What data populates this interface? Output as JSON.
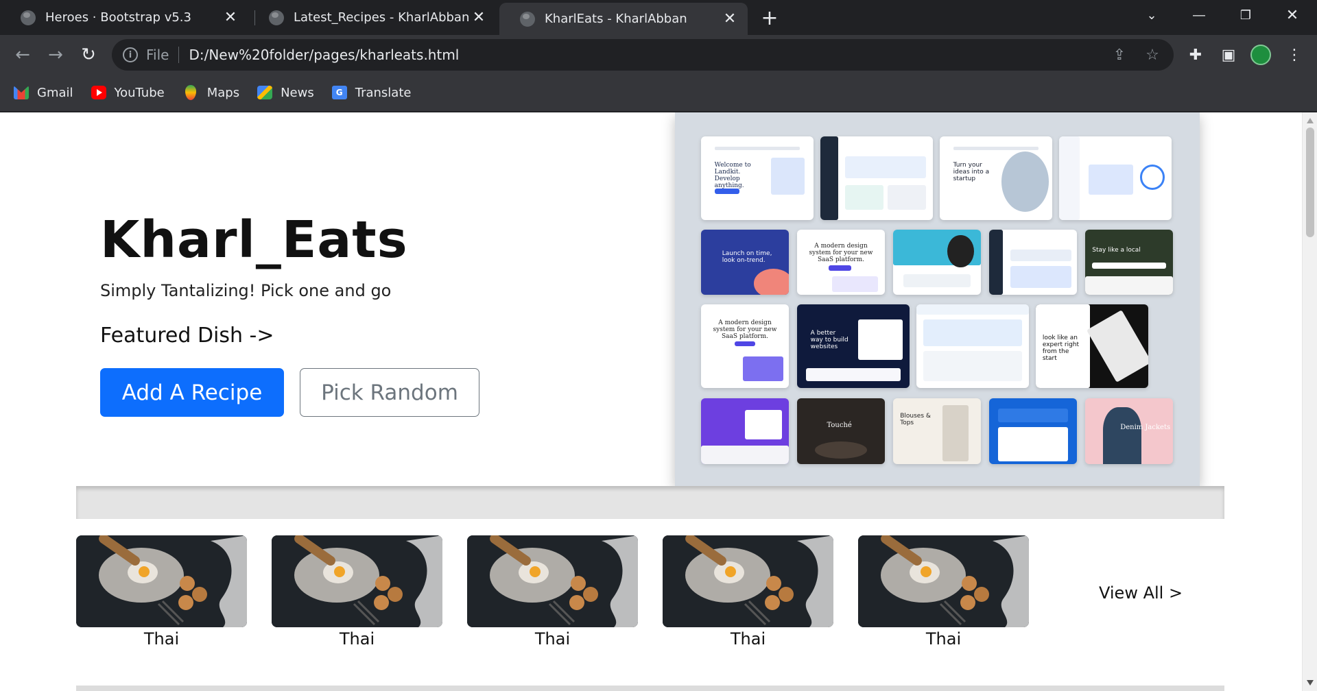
{
  "browser": {
    "tabs": [
      {
        "title": "Heroes · Bootstrap v5.3",
        "active": false
      },
      {
        "title": "Latest_Recipes - KharlAbban",
        "active": false
      },
      {
        "title": "KharlEats - KharlAbban",
        "active": true
      }
    ],
    "address": {
      "scheme_label": "File",
      "url": "D:/New%20folder/pages/kharleats.html"
    },
    "bookmarks": [
      {
        "label": "Gmail",
        "icon": "gmail-icon"
      },
      {
        "label": "YouTube",
        "icon": "youtube-icon"
      },
      {
        "label": "Maps",
        "icon": "maps-icon"
      },
      {
        "label": "News",
        "icon": "news-icon"
      },
      {
        "label": "Translate",
        "icon": "translate-icon"
      }
    ]
  },
  "hero": {
    "title": "Kharl_Eats",
    "lead": "Simply Tantalizing! Pick one and go",
    "featured": "Featured Dish ->",
    "primary_button": "Add A Recipe",
    "secondary_button": "Pick Random"
  },
  "mockups": {
    "row2_col2": "A modern design system for your new SaaS platform.",
    "row3_col1": "A modern design system for your new SaaS platform.",
    "row1_col3": "Turn your ideas into a startup",
    "row2_col1": "Launch on time, look on-trend.",
    "row2_col5": "Stay like a local",
    "row3_col2": "A better way to build websites",
    "row3_col5": "look like an expert right from the start",
    "row4_col3": "Blouses & Tops",
    "row4_col5": "Denim Jackets",
    "row4_col2": "Touché",
    "row1_col1": "Welcome to Landkit. Develop anything."
  },
  "recipes": {
    "cards": [
      {
        "label": "Thai"
      },
      {
        "label": "Thai"
      },
      {
        "label": "Thai"
      },
      {
        "label": "Thai"
      },
      {
        "label": "Thai"
      }
    ],
    "view_all": "View All >"
  },
  "colors": {
    "primary": "#0d6efd",
    "secondary": "#6c757d",
    "chrome_dark": "#202124",
    "chrome_mid": "#35363a"
  }
}
